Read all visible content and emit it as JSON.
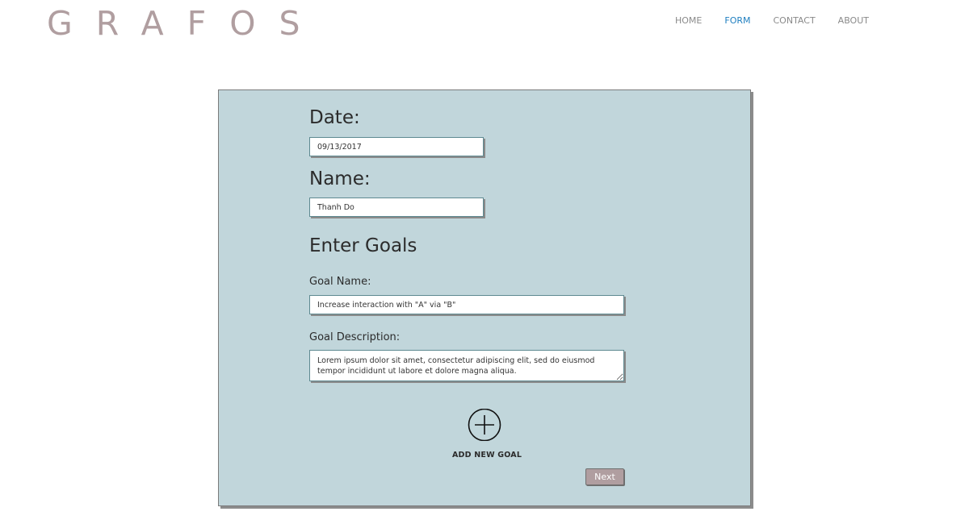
{
  "header": {
    "logo": "GRAFOS",
    "nav": [
      {
        "label": "HOME",
        "active": false
      },
      {
        "label": "FORM",
        "active": true
      },
      {
        "label": "CONTACT",
        "active": false
      },
      {
        "label": "ABOUT",
        "active": false
      }
    ]
  },
  "form": {
    "date_label": "Date:",
    "date_value": "09/13/2017",
    "name_label": "Name:",
    "name_value": "Thanh Do",
    "goals_heading": "Enter Goals",
    "goal_name_label": "Goal Name:",
    "goal_name_value": "Increase interaction with \"A\" via \"B\"",
    "goal_description_label": "Goal Description:",
    "goal_description_value": "Lorem ipsum dolor sit amet, consectetur adipiscing elit, sed do eiusmod tempor incididunt ut labore et dolore magna aliqua.",
    "add_goal_icon": "plus-circle-icon",
    "add_goal_label": "ADD NEW GOAL",
    "next_label": "Next"
  },
  "colors": {
    "logo": "#b09ea0",
    "nav_active": "#1f7fc0",
    "card_background": "#c1d6db",
    "next_button": "#b09ea0"
  }
}
